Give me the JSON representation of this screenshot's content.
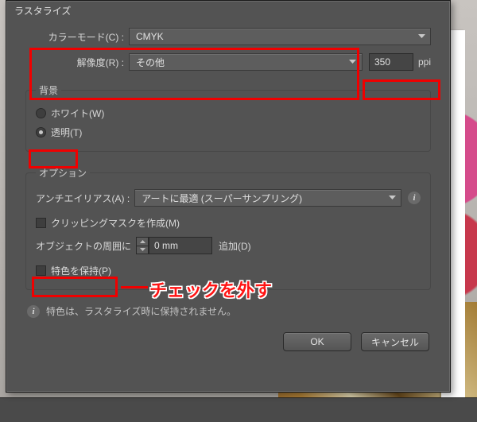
{
  "title": "ラスタライズ",
  "colorMode": {
    "label": "カラーモード(C) :",
    "value": "CMYK"
  },
  "resolution": {
    "label": "解像度(R) :",
    "value": "その他",
    "ppi": "350",
    "unit": "ppi"
  },
  "background": {
    "legend": "背景",
    "white": {
      "label": "ホワイト(W)",
      "checked": false
    },
    "transparent": {
      "label": "透明(T)",
      "checked": true
    }
  },
  "options": {
    "legend": "オプション",
    "antialias": {
      "label": "アンチエイリアス(A) :",
      "value": "アートに最適 (スーパーサンプリング)"
    },
    "clippingMask": {
      "label": "クリッピングマスクを作成(M)",
      "checked": false
    },
    "padding": {
      "prefix": "オブジェクトの周囲に",
      "value": "0 mm",
      "suffix": "追加(D)"
    },
    "preserveSpot": {
      "label": "特色を保持(P)",
      "checked": false
    }
  },
  "note": "特色は、ラスタライズ時に保持されません。",
  "buttons": {
    "ok": "OK",
    "cancel": "キャンセル"
  },
  "annotation": "チェックを外す"
}
